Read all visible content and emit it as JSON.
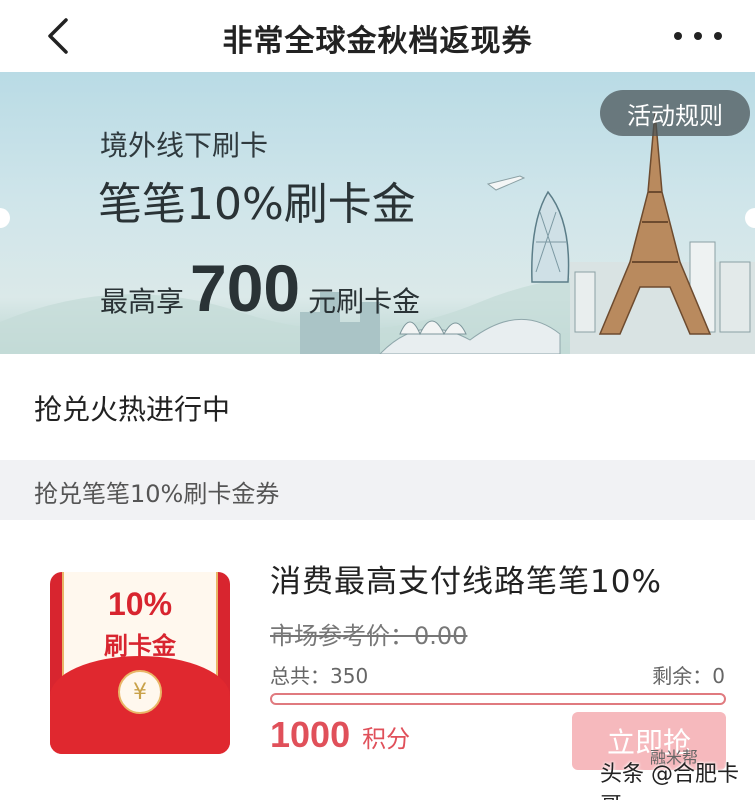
{
  "header": {
    "title": "非常全球金秋档返现券"
  },
  "banner": {
    "rules_button": "活动规则",
    "line1": "境外线下刷卡",
    "line2": "笔笔10%刷卡金",
    "line3_prefix": "最高享",
    "line3_amount": "700",
    "line3_suffix": "元刷卡金"
  },
  "status": {
    "text": "抢兑火热进行中"
  },
  "section": {
    "title": "抢兑笔笔10%刷卡金券"
  },
  "coupon": {
    "badge_percent": "10%",
    "badge_label": "刷卡金",
    "coin_symbol": "¥",
    "title": "消费最高支付线路笔笔10%",
    "market_price": "市场参考价：0.00",
    "total": "总共：350",
    "remaining": "剩余：0",
    "progress_fraction": 0,
    "points_value": "1000",
    "points_unit": "积分",
    "grab_button": "立即抢"
  },
  "watermark": {
    "logo_text": "融米帮",
    "text": "头条 @合肥卡哥"
  }
}
